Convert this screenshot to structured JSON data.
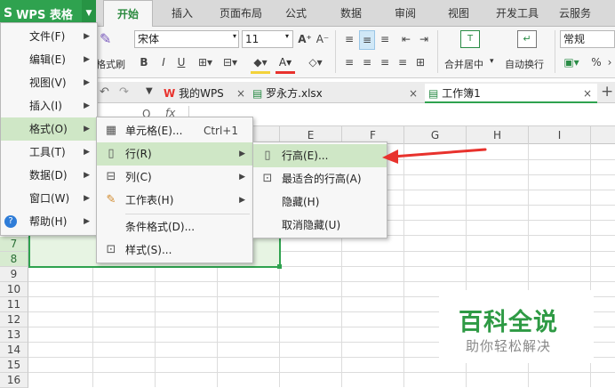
{
  "app": {
    "logo": "S",
    "name": "WPS 表格"
  },
  "ribbon_tabs": [
    "开始",
    "插入",
    "页面布局",
    "公式",
    "数据",
    "审阅",
    "视图",
    "开发工具",
    "云服务"
  ],
  "ribbon": {
    "paste_fmt_label": "格式刷",
    "font_name": "宋体",
    "font_size": "11",
    "bold": "B",
    "italic": "I",
    "underline": "U",
    "merge_label": "合并居中",
    "wrap_label": "自动换行",
    "number_format": "常规",
    "percent": "%"
  },
  "doc_tabs": [
    {
      "label": "我的WPS",
      "icon": "wps-w-icon",
      "closable": true
    },
    {
      "label": "罗永方.xlsx",
      "icon": "sheet-icon",
      "closable": true
    },
    {
      "label": "工作簿1",
      "icon": "sheet-icon",
      "closable": true
    }
  ],
  "formula_bar": {
    "fx": "fx",
    "q": "Q"
  },
  "columns": [
    "E",
    "F",
    "G",
    "H",
    "I"
  ],
  "rows": [
    "7",
    "8",
    "9",
    "10",
    "11",
    "12",
    "13",
    "14",
    "15",
    "16"
  ],
  "main_menu": [
    {
      "label": "文件(F)",
      "submenu": true
    },
    {
      "label": "编辑(E)",
      "submenu": true
    },
    {
      "label": "视图(V)",
      "submenu": true
    },
    {
      "label": "插入(I)",
      "submenu": true
    },
    {
      "label": "格式(O)",
      "submenu": true,
      "highlighted": true
    },
    {
      "label": "工具(T)",
      "submenu": true
    },
    {
      "label": "数据(D)",
      "submenu": true
    },
    {
      "label": "窗口(W)",
      "submenu": true
    },
    {
      "label": "帮助(H)",
      "submenu": true
    }
  ],
  "format_menu": [
    {
      "label": "单元格(E)...",
      "shortcut": "Ctrl+1",
      "icon": "cell-format-icon"
    },
    {
      "label": "行(R)",
      "submenu": true,
      "highlighted": true,
      "icon": "row-icon"
    },
    {
      "label": "列(C)",
      "submenu": true,
      "icon": "column-icon"
    },
    {
      "label": "工作表(H)",
      "submenu": true,
      "icon": "worksheet-icon"
    },
    {
      "label": "条件格式(D)..."
    },
    {
      "label": "样式(S)...",
      "icon": "style-icon"
    }
  ],
  "row_menu": [
    {
      "label": "行高(E)...",
      "highlighted": true,
      "icon": "row-height-icon"
    },
    {
      "label": "最适合的行高(A)",
      "icon": "autofit-row-icon"
    },
    {
      "label": "隐藏(H)"
    },
    {
      "label": "取消隐藏(U)"
    }
  ],
  "watermark": {
    "title": "百科全说",
    "subtitle": "助你轻松解决"
  },
  "colors": {
    "accent": "#2fa24f",
    "highlight": "#cfe7c6",
    "arrow": "#e8322d"
  }
}
